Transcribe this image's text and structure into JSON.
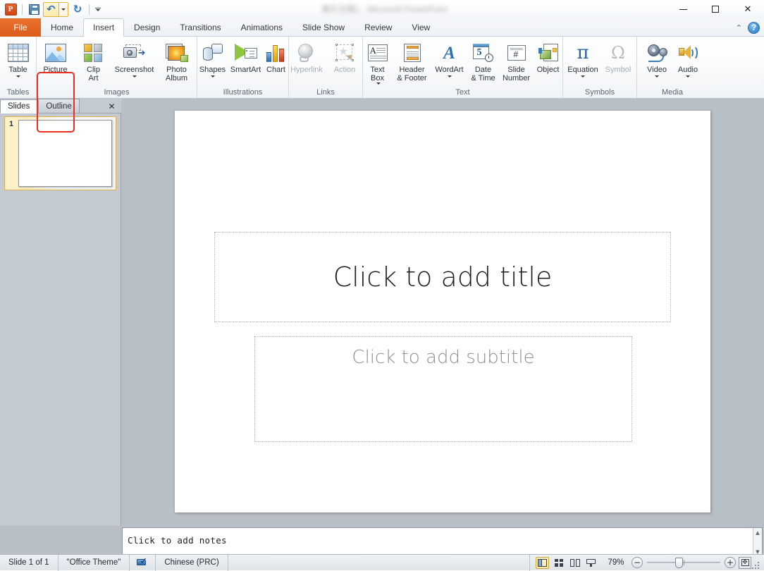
{
  "window": {
    "title_blurred": "演示文稿1 - Microsoft PowerPoint",
    "minimize": "—",
    "maximize": "□",
    "close": "✕"
  },
  "quick_access": {
    "app_logo": "P",
    "save_label": "Save",
    "undo_label": "Undo",
    "redo_label": "Redo",
    "customize_label": "Customize Quick Access Toolbar"
  },
  "tabs": {
    "file": "File",
    "items": [
      {
        "label": "Home",
        "active": false
      },
      {
        "label": "Insert",
        "active": true
      },
      {
        "label": "Design",
        "active": false
      },
      {
        "label": "Transitions",
        "active": false
      },
      {
        "label": "Animations",
        "active": false
      },
      {
        "label": "Slide Show",
        "active": false
      },
      {
        "label": "Review",
        "active": false
      },
      {
        "label": "View",
        "active": false
      }
    ],
    "collapse_icon": "⌃",
    "help_icon": "?"
  },
  "ribbon": {
    "groups": [
      {
        "name": "Tables",
        "label": "Tables",
        "buttons": [
          {
            "id": "table",
            "label": "Table",
            "icon": "table-icon",
            "dropdown": true,
            "disabled": false
          }
        ]
      },
      {
        "name": "Images",
        "label": "Images",
        "buttons": [
          {
            "id": "picture",
            "label": "Picture",
            "icon": "picture-icon",
            "dropdown": false,
            "disabled": false,
            "highlighted": true
          },
          {
            "id": "clip-art",
            "label": "Clip\nArt",
            "icon": "clip-art-icon",
            "dropdown": true,
            "disabled": false
          },
          {
            "id": "screenshot",
            "label": "Screenshot",
            "icon": "screenshot-icon",
            "dropdown": true,
            "disabled": false
          },
          {
            "id": "photo-album",
            "label": "Photo\nAlbum",
            "icon": "photo-album-icon",
            "dropdown": true,
            "disabled": false
          }
        ]
      },
      {
        "name": "Illustrations",
        "label": "Illustrations",
        "buttons": [
          {
            "id": "shapes",
            "label": "Shapes",
            "icon": "shapes-icon",
            "dropdown": true,
            "disabled": false
          },
          {
            "id": "smartart",
            "label": "SmartArt",
            "icon": "smartart-icon",
            "dropdown": false,
            "disabled": false
          },
          {
            "id": "chart",
            "label": "Chart",
            "icon": "chart-icon",
            "dropdown": false,
            "disabled": false
          }
        ]
      },
      {
        "name": "Links",
        "label": "Links",
        "buttons": [
          {
            "id": "hyperlink",
            "label": "Hyperlink",
            "icon": "hyperlink-icon",
            "dropdown": false,
            "disabled": true
          },
          {
            "id": "action",
            "label": "Action",
            "icon": "action-icon",
            "dropdown": false,
            "disabled": true
          }
        ]
      },
      {
        "name": "Text",
        "label": "Text",
        "buttons": [
          {
            "id": "text-box",
            "label": "Text\nBox",
            "icon": "text-box-icon",
            "dropdown": true,
            "disabled": false
          },
          {
            "id": "header-footer",
            "label": "Header\n& Footer",
            "icon": "header-footer-icon",
            "dropdown": false,
            "disabled": false
          },
          {
            "id": "wordart",
            "label": "WordArt",
            "icon": "wordart-icon",
            "dropdown": true,
            "disabled": false
          },
          {
            "id": "date-time",
            "label": "Date\n& Time",
            "icon": "date-time-icon",
            "dropdown": false,
            "disabled": false
          },
          {
            "id": "slide-number",
            "label": "Slide\nNumber",
            "icon": "slide-number-icon",
            "dropdown": false,
            "disabled": false
          },
          {
            "id": "object",
            "label": "Object",
            "icon": "object-icon",
            "dropdown": false,
            "disabled": false
          }
        ]
      },
      {
        "name": "Symbols",
        "label": "Symbols",
        "buttons": [
          {
            "id": "equation",
            "label": "Equation",
            "icon": "equation-icon",
            "dropdown": true,
            "disabled": false,
            "glyph": "π"
          },
          {
            "id": "symbol",
            "label": "Symbol",
            "icon": "symbol-icon",
            "dropdown": false,
            "disabled": true,
            "glyph": "Ω"
          }
        ]
      },
      {
        "name": "Media",
        "label": "Media",
        "buttons": [
          {
            "id": "video",
            "label": "Video",
            "icon": "video-icon",
            "dropdown": true,
            "disabled": false
          },
          {
            "id": "audio",
            "label": "Audio",
            "icon": "audio-icon",
            "dropdown": true,
            "disabled": false
          }
        ]
      }
    ],
    "highlight_color": "#ee2b20"
  },
  "left_pane": {
    "tab_slides": "Slides",
    "tab_outline": "Outline",
    "close_icon": "✕",
    "active_tab": "Slides",
    "slides": [
      {
        "number": "1",
        "selected": true
      }
    ]
  },
  "slide": {
    "title_placeholder": "Click to add title",
    "subtitle_placeholder": "Click to add subtitle"
  },
  "notes": {
    "placeholder": "Click to add notes",
    "scroll_up": "▲",
    "scroll_down": "▼"
  },
  "status_bar": {
    "slide_count": "Slide 1 of 1",
    "theme": "\"Office Theme\"",
    "language": "Chinese (PRC)",
    "spellcheck_icon": "spellcheck-icon",
    "views": [
      {
        "id": "normal",
        "label": "Normal",
        "active": true
      },
      {
        "id": "slide-sorter",
        "label": "Slide Sorter",
        "active": false
      },
      {
        "id": "reading-view",
        "label": "Reading View",
        "active": false
      },
      {
        "id": "slide-show",
        "label": "Slide Show",
        "active": false
      }
    ],
    "zoom_level": "79%",
    "zoom_out": "−",
    "zoom_in": "+",
    "fit_label": "Fit slide to current window"
  }
}
